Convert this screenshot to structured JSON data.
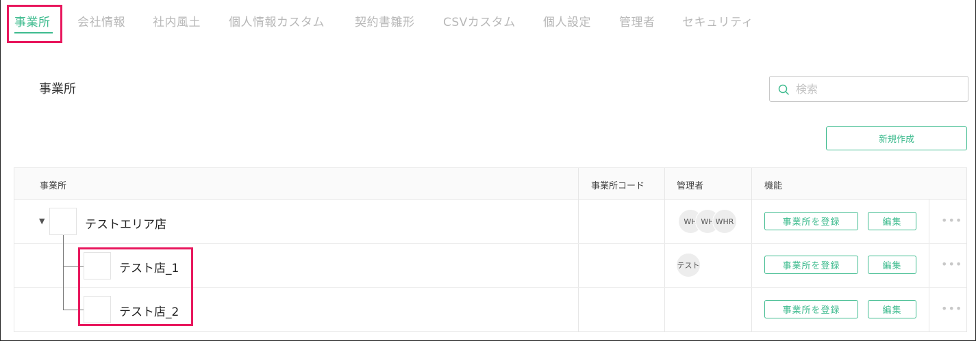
{
  "tabs": [
    {
      "label": "事業所",
      "active": true
    },
    {
      "label": "会社情報"
    },
    {
      "label": "社内風土"
    },
    {
      "label": "個人情報カスタム"
    },
    {
      "label": "契約書雛形"
    },
    {
      "label": "CSVカスタム"
    },
    {
      "label": "個人設定"
    },
    {
      "label": "管理者"
    },
    {
      "label": "セキュリティ"
    }
  ],
  "page": {
    "title": "事業所"
  },
  "search": {
    "placeholder": "検索"
  },
  "toolbar": {
    "new_label": "新規作成"
  },
  "table": {
    "headers": [
      "事業所",
      "事業所コード",
      "管理者",
      "機能"
    ],
    "rows": [
      {
        "name": "テストエリア店",
        "code": "",
        "admins": [
          "WH",
          "WH",
          "WHR"
        ],
        "register_label": "事業所を登録",
        "edit_label": "編集",
        "more": "•••"
      },
      {
        "name": "テスト店_1",
        "code": "",
        "admins": [
          "テスト"
        ],
        "register_label": "事業所を登録",
        "edit_label": "編集",
        "more": "•••"
      },
      {
        "name": "テスト店_2",
        "code": "",
        "admins": [],
        "register_label": "事業所を登録",
        "edit_label": "編集",
        "more": "•••"
      }
    ]
  },
  "colors": {
    "accent": "#3dbb8e",
    "highlight": "#e8175d"
  },
  "icons": {
    "search": "search-icon",
    "caret": "caret-down-icon",
    "more": "more-horizontal-icon"
  }
}
